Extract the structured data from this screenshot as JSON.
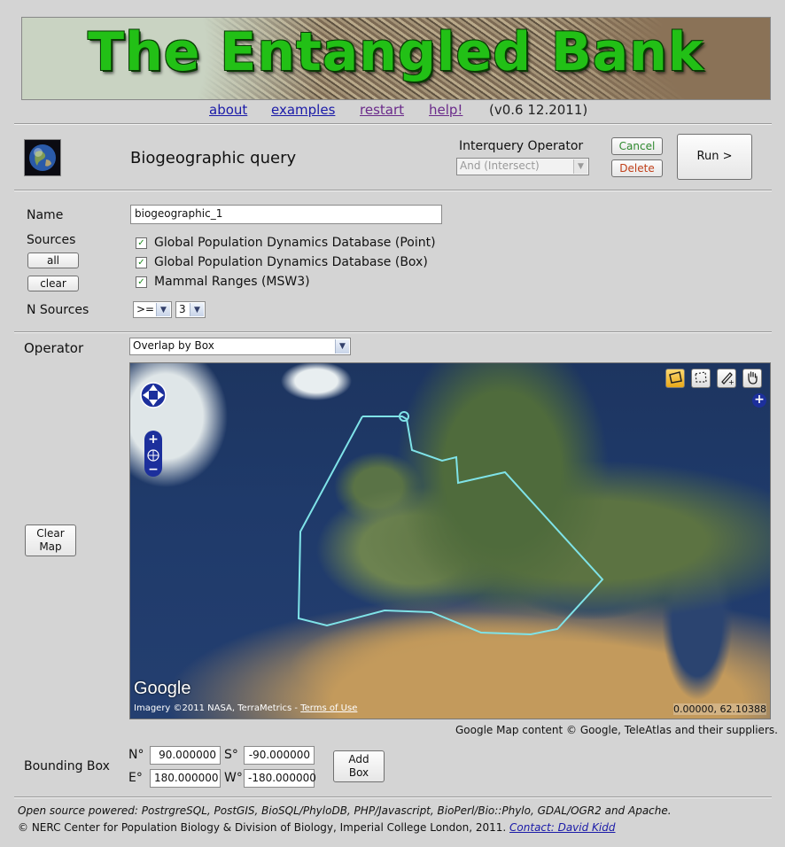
{
  "banner": {
    "title": "The Entangled Bank"
  },
  "nav": {
    "about": "about",
    "examples": "examples",
    "restart": "restart",
    "help": "help!",
    "version": "(v0.6 12.2011)"
  },
  "query": {
    "title": "Biogeographic query",
    "interquery_label": "Interquery Operator",
    "interquery_value": "And (Intersect)",
    "cancel": "Cancel",
    "delete": "Delete",
    "run": "Run >"
  },
  "form": {
    "name_label": "Name",
    "name_value": "biogeographic_1",
    "sources_label": "Sources",
    "all_button": "all",
    "clear_button": "clear",
    "sources": [
      {
        "label": "Global Population Dynamics Database (Point)",
        "checked": true
      },
      {
        "label": "Global Population Dynamics Database (Box)",
        "checked": true
      },
      {
        "label": "Mammal Ranges (MSW3)",
        "checked": true
      }
    ],
    "n_sources_label": "N Sources",
    "n_operator": ">=",
    "n_value": "3",
    "operator_label": "Operator",
    "operator_value": "Overlap by Box",
    "clear_map": "Clear Map"
  },
  "map": {
    "google_logo": "Google",
    "imagery": "Imagery ©2011 NASA, TerraMetrics -",
    "terms": "Terms of Use",
    "coords": "0.00000, 62.10388",
    "credit": "Google Map content © Google, TeleAtlas and their suppliers.",
    "outline_color": "#7fe3e8",
    "tools": [
      "polygon-tool-icon",
      "box-tool-icon",
      "draw-tool-icon",
      "pan-hand-icon"
    ]
  },
  "bbox": {
    "label": "Bounding Box",
    "n_label": "N°",
    "s_label": "S°",
    "e_label": "E°",
    "w_label": "W°",
    "n": "90.000000",
    "s": "-90.000000",
    "e": "180.000000",
    "w": "-180.000000",
    "add_box": "Add Box"
  },
  "footer": {
    "line1": "Open source powered: PostrgreSQL, PostGIS, BioSQL/PhyloDB, PHP/Javascript, BioPerl/Bio::Phylo, GDAL/OGR2 and Apache.",
    "line2": "© NERC Center for Population Biology & Division of Biology, Imperial College London, 2011.",
    "contact": "Contact: David Kidd"
  }
}
